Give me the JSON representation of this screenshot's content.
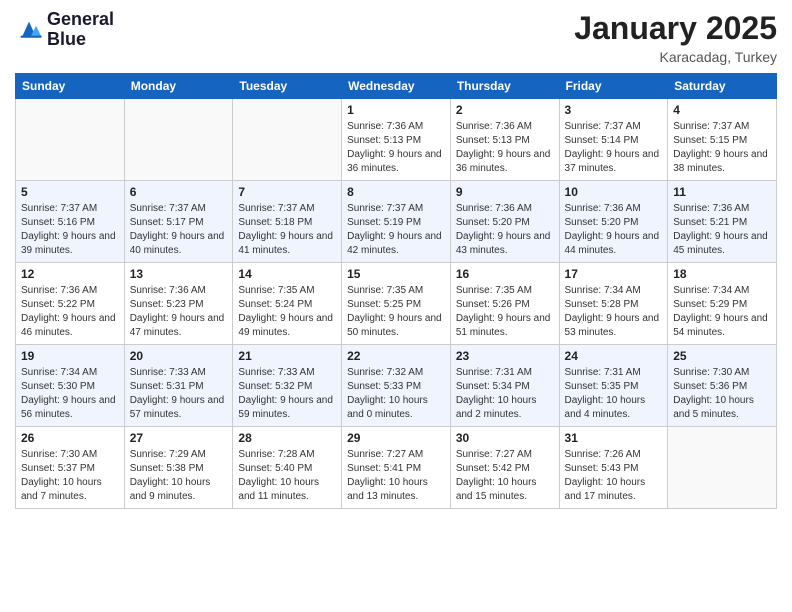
{
  "logo": {
    "line1": "General",
    "line2": "Blue"
  },
  "title": "January 2025",
  "subtitle": "Karacadag, Turkey",
  "days_header": [
    "Sunday",
    "Monday",
    "Tuesday",
    "Wednesday",
    "Thursday",
    "Friday",
    "Saturday"
  ],
  "weeks": [
    [
      {
        "day": "",
        "info": ""
      },
      {
        "day": "",
        "info": ""
      },
      {
        "day": "",
        "info": ""
      },
      {
        "day": "1",
        "info": "Sunrise: 7:36 AM\nSunset: 5:13 PM\nDaylight: 9 hours and 36 minutes."
      },
      {
        "day": "2",
        "info": "Sunrise: 7:36 AM\nSunset: 5:13 PM\nDaylight: 9 hours and 36 minutes."
      },
      {
        "day": "3",
        "info": "Sunrise: 7:37 AM\nSunset: 5:14 PM\nDaylight: 9 hours and 37 minutes."
      },
      {
        "day": "4",
        "info": "Sunrise: 7:37 AM\nSunset: 5:15 PM\nDaylight: 9 hours and 38 minutes."
      }
    ],
    [
      {
        "day": "5",
        "info": "Sunrise: 7:37 AM\nSunset: 5:16 PM\nDaylight: 9 hours and 39 minutes."
      },
      {
        "day": "6",
        "info": "Sunrise: 7:37 AM\nSunset: 5:17 PM\nDaylight: 9 hours and 40 minutes."
      },
      {
        "day": "7",
        "info": "Sunrise: 7:37 AM\nSunset: 5:18 PM\nDaylight: 9 hours and 41 minutes."
      },
      {
        "day": "8",
        "info": "Sunrise: 7:37 AM\nSunset: 5:19 PM\nDaylight: 9 hours and 42 minutes."
      },
      {
        "day": "9",
        "info": "Sunrise: 7:36 AM\nSunset: 5:20 PM\nDaylight: 9 hours and 43 minutes."
      },
      {
        "day": "10",
        "info": "Sunrise: 7:36 AM\nSunset: 5:20 PM\nDaylight: 9 hours and 44 minutes."
      },
      {
        "day": "11",
        "info": "Sunrise: 7:36 AM\nSunset: 5:21 PM\nDaylight: 9 hours and 45 minutes."
      }
    ],
    [
      {
        "day": "12",
        "info": "Sunrise: 7:36 AM\nSunset: 5:22 PM\nDaylight: 9 hours and 46 minutes."
      },
      {
        "day": "13",
        "info": "Sunrise: 7:36 AM\nSunset: 5:23 PM\nDaylight: 9 hours and 47 minutes."
      },
      {
        "day": "14",
        "info": "Sunrise: 7:35 AM\nSunset: 5:24 PM\nDaylight: 9 hours and 49 minutes."
      },
      {
        "day": "15",
        "info": "Sunrise: 7:35 AM\nSunset: 5:25 PM\nDaylight: 9 hours and 50 minutes."
      },
      {
        "day": "16",
        "info": "Sunrise: 7:35 AM\nSunset: 5:26 PM\nDaylight: 9 hours and 51 minutes."
      },
      {
        "day": "17",
        "info": "Sunrise: 7:34 AM\nSunset: 5:28 PM\nDaylight: 9 hours and 53 minutes."
      },
      {
        "day": "18",
        "info": "Sunrise: 7:34 AM\nSunset: 5:29 PM\nDaylight: 9 hours and 54 minutes."
      }
    ],
    [
      {
        "day": "19",
        "info": "Sunrise: 7:34 AM\nSunset: 5:30 PM\nDaylight: 9 hours and 56 minutes."
      },
      {
        "day": "20",
        "info": "Sunrise: 7:33 AM\nSunset: 5:31 PM\nDaylight: 9 hours and 57 minutes."
      },
      {
        "day": "21",
        "info": "Sunrise: 7:33 AM\nSunset: 5:32 PM\nDaylight: 9 hours and 59 minutes."
      },
      {
        "day": "22",
        "info": "Sunrise: 7:32 AM\nSunset: 5:33 PM\nDaylight: 10 hours and 0 minutes."
      },
      {
        "day": "23",
        "info": "Sunrise: 7:31 AM\nSunset: 5:34 PM\nDaylight: 10 hours and 2 minutes."
      },
      {
        "day": "24",
        "info": "Sunrise: 7:31 AM\nSunset: 5:35 PM\nDaylight: 10 hours and 4 minutes."
      },
      {
        "day": "25",
        "info": "Sunrise: 7:30 AM\nSunset: 5:36 PM\nDaylight: 10 hours and 5 minutes."
      }
    ],
    [
      {
        "day": "26",
        "info": "Sunrise: 7:30 AM\nSunset: 5:37 PM\nDaylight: 10 hours and 7 minutes."
      },
      {
        "day": "27",
        "info": "Sunrise: 7:29 AM\nSunset: 5:38 PM\nDaylight: 10 hours and 9 minutes."
      },
      {
        "day": "28",
        "info": "Sunrise: 7:28 AM\nSunset: 5:40 PM\nDaylight: 10 hours and 11 minutes."
      },
      {
        "day": "29",
        "info": "Sunrise: 7:27 AM\nSunset: 5:41 PM\nDaylight: 10 hours and 13 minutes."
      },
      {
        "day": "30",
        "info": "Sunrise: 7:27 AM\nSunset: 5:42 PM\nDaylight: 10 hours and 15 minutes."
      },
      {
        "day": "31",
        "info": "Sunrise: 7:26 AM\nSunset: 5:43 PM\nDaylight: 10 hours and 17 minutes."
      },
      {
        "day": "",
        "info": ""
      }
    ]
  ]
}
